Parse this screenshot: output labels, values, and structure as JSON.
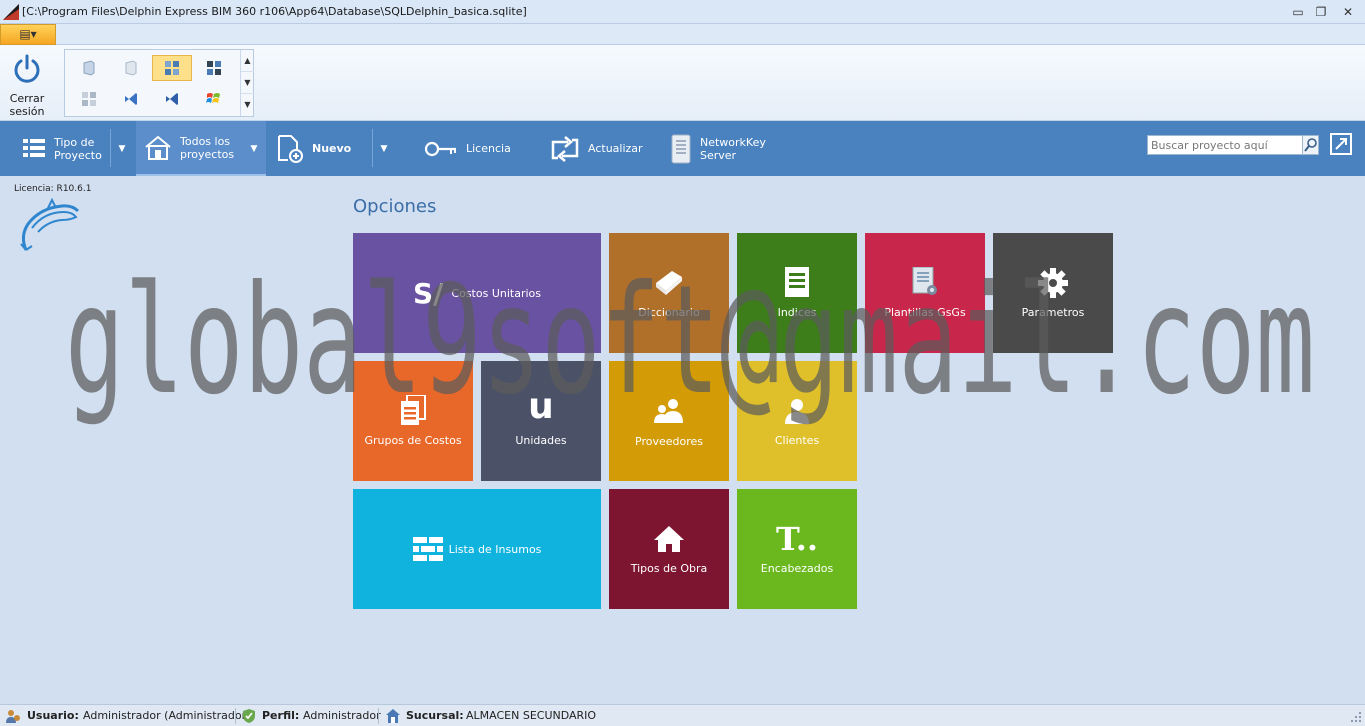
{
  "window": {
    "title": "[C:\\Program Files\\Delphin Express BIM 360 r106\\App64\\Database\\SQLDelphin_basica.sqlite]",
    "minimize_glyph": "▭",
    "restore_glyph": "❐",
    "close_glyph": "✕"
  },
  "menu": {
    "app_button_glyph": "▤▾"
  },
  "ribbon": {
    "logout_label_line1": "Cerrar",
    "logout_label_line2": "sesión",
    "style_gallery": [
      "office-2007-icon",
      "office-2010-icon",
      "office-blue-icon",
      "office-black-icon",
      "office-silver-icon",
      "vs2010-icon",
      "vs2012-icon",
      "windows7-icon"
    ]
  },
  "toolbar": {
    "tipo_line1": "Tipo de",
    "tipo_line2": "Proyecto",
    "todos_line1": "Todos los",
    "todos_line2": "proyectos",
    "nuevo": "Nuevo",
    "licencia": "Licencia",
    "actualizar": "Actualizar",
    "network_line1": "NetworkKey",
    "network_line2": "Server",
    "dropdown_glyph": "▼",
    "search_placeholder": "Buscar proyecto aquí"
  },
  "sidebar": {
    "license": "Licencia: R10.6.1"
  },
  "main": {
    "title": "Opciones",
    "tiles": {
      "costos_unitarios": {
        "label": "Costos Unitarios",
        "glyph": "S/",
        "color": "#6a52a3"
      },
      "diccionario": {
        "label": "Diccionario",
        "color": "#b0702a"
      },
      "indices": {
        "label": "Indices",
        "color": "#3d7e1a"
      },
      "plantillas": {
        "label": "Plantillas GsGs",
        "color": "#c8264a"
      },
      "parametros": {
        "label": "Parametros",
        "color": "#4a4a4a"
      },
      "grupos": {
        "label": "Grupos de Costos",
        "color": "#e8682a"
      },
      "unidades": {
        "label": "Unidades",
        "glyph": "u",
        "color": "#4b5268"
      },
      "proveedores": {
        "label": "Proveedores",
        "color": "#d39b06"
      },
      "clientes": {
        "label": "Clientes",
        "color": "#e0c02a"
      },
      "insumos": {
        "label": "Lista de Insumos",
        "color": "#10b3de"
      },
      "tipos_obra": {
        "label": "Tipos de Obra",
        "color": "#7e1530"
      },
      "encabezados": {
        "label": "Encabezados",
        "glyph": "T..",
        "color": "#6bb81e"
      }
    }
  },
  "watermark": "global9soft@gmail.com",
  "status": {
    "usuario_label": "Usuario:",
    "usuario_value": "Administrador (Administrador)",
    "perfil_label": "Perfil:",
    "perfil_value": "Administrador",
    "sucursal_label": "Sucursal:",
    "sucursal_value": "ALMACEN SECUNDARIO"
  }
}
